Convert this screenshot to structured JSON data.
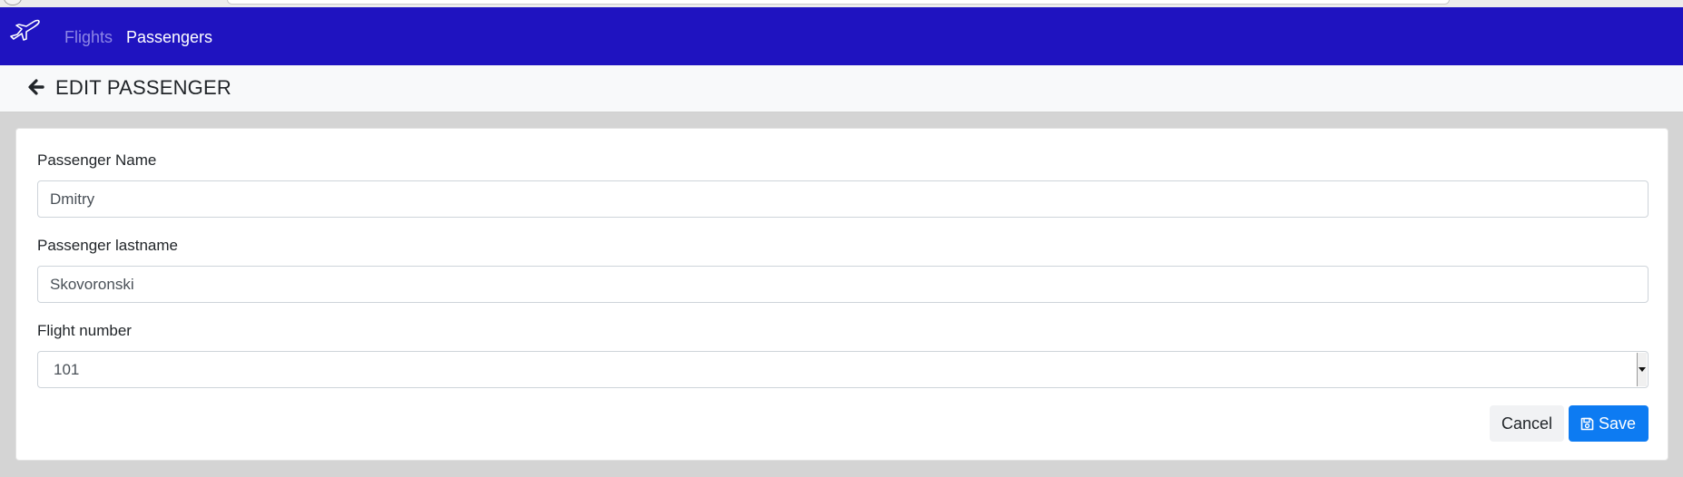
{
  "nav": {
    "brand_icon": "airplane-icon",
    "links": [
      {
        "label": "Flights",
        "active": false
      },
      {
        "label": "Passengers",
        "active": true
      }
    ],
    "bar_color": "#1f13c0"
  },
  "header": {
    "back_icon": "arrow-left-icon",
    "title": "EDIT PASSENGER"
  },
  "form": {
    "name": {
      "label": "Passenger Name",
      "value": "Dmitry"
    },
    "lastname": {
      "label": "Passenger lastname",
      "value": "Skovoronski"
    },
    "flight": {
      "label": "Flight number",
      "selected": "101"
    }
  },
  "actions": {
    "cancel_label": "Cancel",
    "save_label": "Save",
    "save_icon": "floppy-disk-icon",
    "save_color": "#0d7bf2"
  }
}
